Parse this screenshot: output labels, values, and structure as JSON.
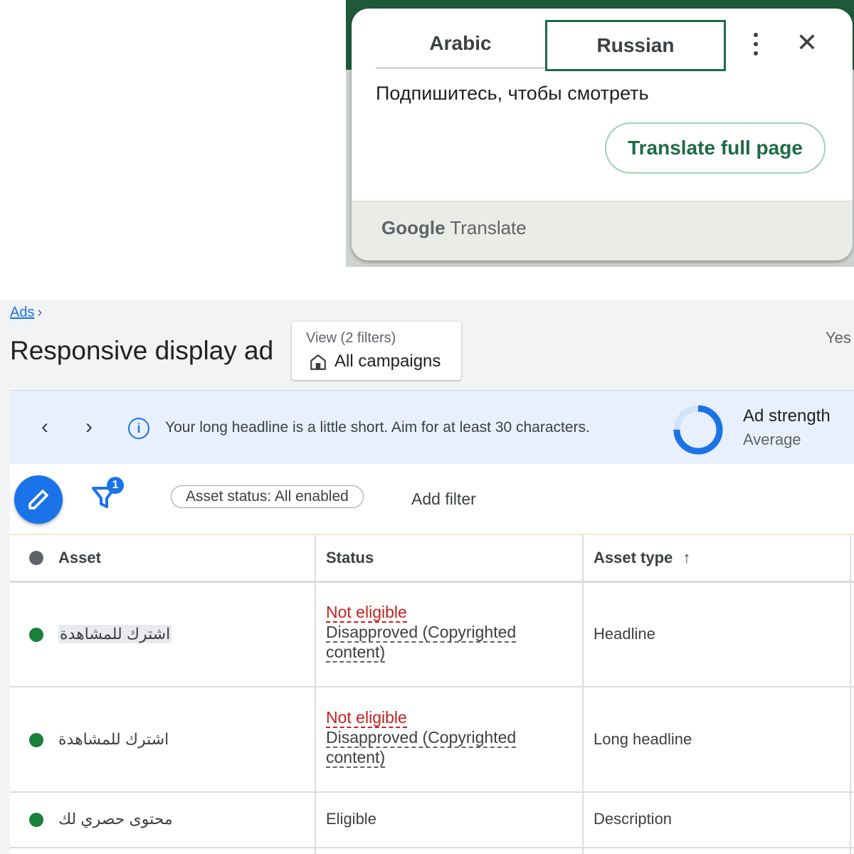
{
  "translate_popup": {
    "tab_source": "Arabic",
    "tab_target": "Russian",
    "translated_text": "Подпишитесь, чтобы смотреть",
    "translate_full_page_label": "Translate full page",
    "footer_logo_google": "Google",
    "footer_logo_translate": "Translate",
    "accent_color": "#1e6b45"
  },
  "ads": {
    "breadcrumb": "Ads",
    "page_title": "Responsive display ad",
    "view_card": {
      "label": "View (2 filters)",
      "value": "All campaigns"
    },
    "right_clipped_text": "Yes",
    "banner": {
      "message": "Your long headline is a little short. Aim for at least 30 characters.",
      "ad_strength_label": "Ad strength",
      "ad_strength_value": "Average",
      "ad_strength_fill": 0.75
    },
    "toolbar": {
      "filter_count": "1",
      "status_chip": "Asset status: All enabled",
      "add_filter": "Add filter"
    },
    "table": {
      "columns": [
        "Asset",
        "Status",
        "Asset type"
      ],
      "sort_indicator": "↑",
      "rows": [
        {
          "asset": "اشترك للمشاهدة",
          "status": "Not eligible",
          "status_detail": "Disapproved (Copyrighted content)",
          "type": "Headline"
        },
        {
          "asset": "اشترك للمشاهدة",
          "status": "Not eligible",
          "status_detail": "Disapproved (Copyrighted content)",
          "type": "Long headline"
        },
        {
          "asset": "محتوى حصري لك",
          "status": "Eligible",
          "status_detail": "",
          "type": "Description"
        }
      ]
    },
    "colors": {
      "primary_blue": "#1a73e8",
      "error_red": "#c5221f",
      "enabled_green": "#188038"
    }
  }
}
